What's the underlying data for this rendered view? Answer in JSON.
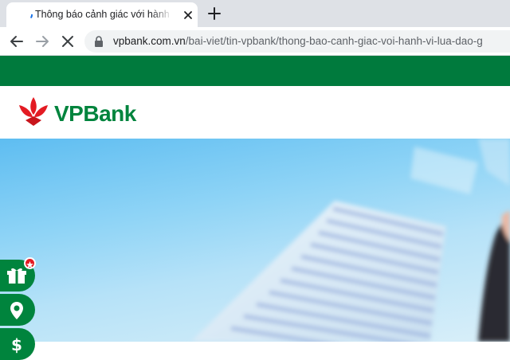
{
  "browser": {
    "tab": {
      "title": "Thông báo cảnh giác với hành vi lừa đảo"
    },
    "url": {
      "domain": "vpbank.com.vn",
      "path": "/bai-viet/tin-vpbank/thong-bao-canh-giac-voi-hanh-vi-lua-dao-g"
    }
  },
  "site": {
    "logo_text": "VPBank",
    "brand_color": "#00843d",
    "accent_color": "#e31b23",
    "top_bar_color": "#007a3d"
  },
  "floating_buttons": [
    {
      "icon": "gift-icon"
    },
    {
      "icon": "location-pin-icon"
    },
    {
      "icon": "dollar-icon"
    }
  ]
}
